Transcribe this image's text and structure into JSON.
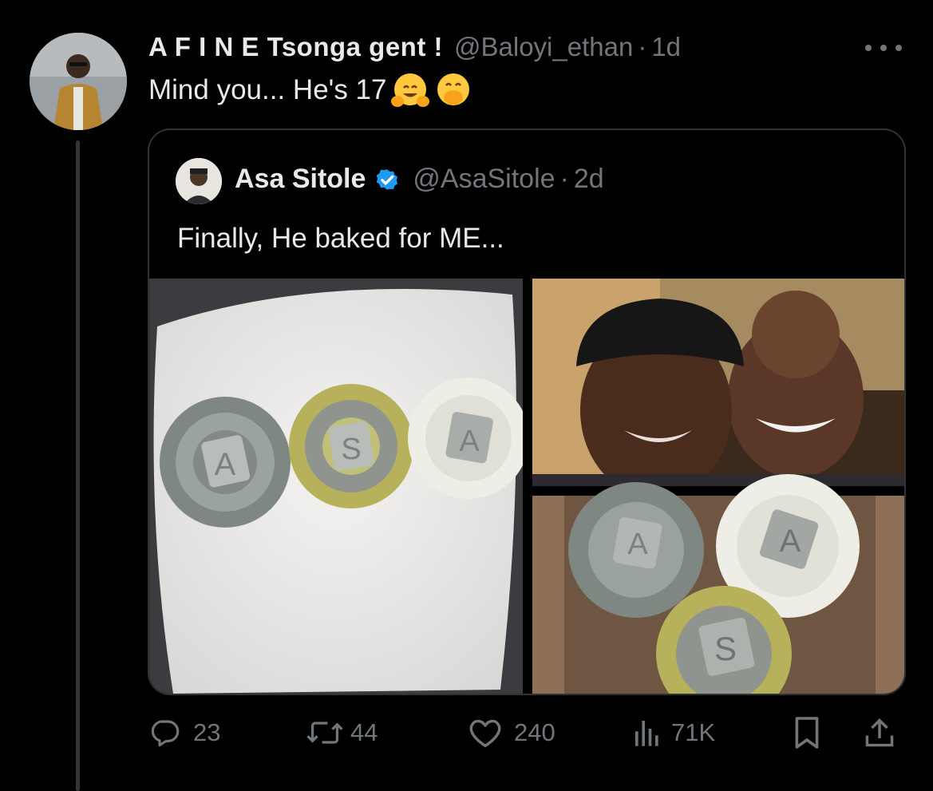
{
  "tweet": {
    "display_name": "A F I N E Tsonga gent !",
    "handle": "@Baloyi_ethan",
    "separator": "·",
    "time": "1d",
    "text": "Mind you... He's 17",
    "emojis": [
      "hugging-face-emoji",
      "hand-over-mouth-emoji"
    ]
  },
  "quote": {
    "display_name": "Asa Sitole",
    "verified": true,
    "handle": "@AsaSitole",
    "separator": "·",
    "time": "2d",
    "text": "Finally, He baked for ME...",
    "media_letters": {
      "left": [
        "A",
        "S",
        "A"
      ],
      "bottom_right": [
        "A",
        "A",
        "S"
      ]
    }
  },
  "actions": {
    "replies": "23",
    "reposts": "44",
    "likes": "240",
    "views": "71K"
  },
  "colors": {
    "background": "#000000",
    "primary_text": "#e7e9ea",
    "secondary_text": "#71767b",
    "border": "#2f3336",
    "verified_blue": "#1d9bf0"
  },
  "icons": [
    "more-icon",
    "verified-icon",
    "reply-icon",
    "repost-icon",
    "like-icon",
    "views-icon",
    "bookmark-icon",
    "share-icon"
  ]
}
